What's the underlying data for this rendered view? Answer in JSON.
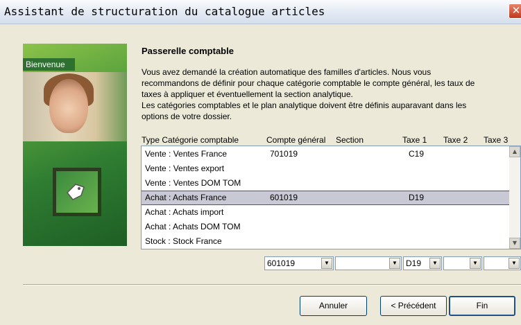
{
  "window": {
    "title": "Assistant de structuration du catalogue articles",
    "close_glyph": "✕"
  },
  "sidebar": {
    "badge": "Bienvenue",
    "icon": "price-tag-icon"
  },
  "content": {
    "heading": "Passerelle comptable",
    "paragraph_lines": [
      "Vous avez demandé la création automatique des familles d'articles. Nous vous",
      "recommandons de définir pour chaque catégorie comptable le compte général, les taux de",
      "taxes à appliquer et éventuellement la section analytique.",
      "Les catégories  comptables et le plan analytique doivent être définis auparavant dans les",
      "options de votre dossier."
    ]
  },
  "table": {
    "headers": [
      "Type Catégorie comptable",
      "Compte général",
      "Section",
      "Taxe 1",
      "Taxe 2",
      "Taxe 3"
    ],
    "rows": [
      [
        "Vente : Ventes France",
        "701019",
        "",
        "C19",
        "",
        ""
      ],
      [
        "Vente : Ventes export",
        "",
        "",
        "",
        "",
        ""
      ],
      [
        "Vente : Ventes DOM TOM",
        "",
        "",
        "",
        "",
        ""
      ],
      [
        "Achat : Achats France",
        "601019",
        "",
        "D19",
        "",
        ""
      ],
      [
        "Achat : Achats import",
        "",
        "",
        "",
        "",
        ""
      ],
      [
        "Achat : Achats DOM TOM",
        "",
        "",
        "",
        "",
        ""
      ],
      [
        "Stock : Stock France",
        "",
        "",
        "",
        "",
        ""
      ]
    ],
    "selected_row_index": 3
  },
  "editors": {
    "compte_general": "601019",
    "section": "",
    "taxe1": "D19",
    "taxe2": "",
    "taxe3": ""
  },
  "buttons": {
    "cancel": "Annuler",
    "previous": "< Précédent",
    "finish": "Fin"
  },
  "colors": {
    "selection": "#c9c9d6",
    "sidebar_green": "#2f7d32"
  }
}
